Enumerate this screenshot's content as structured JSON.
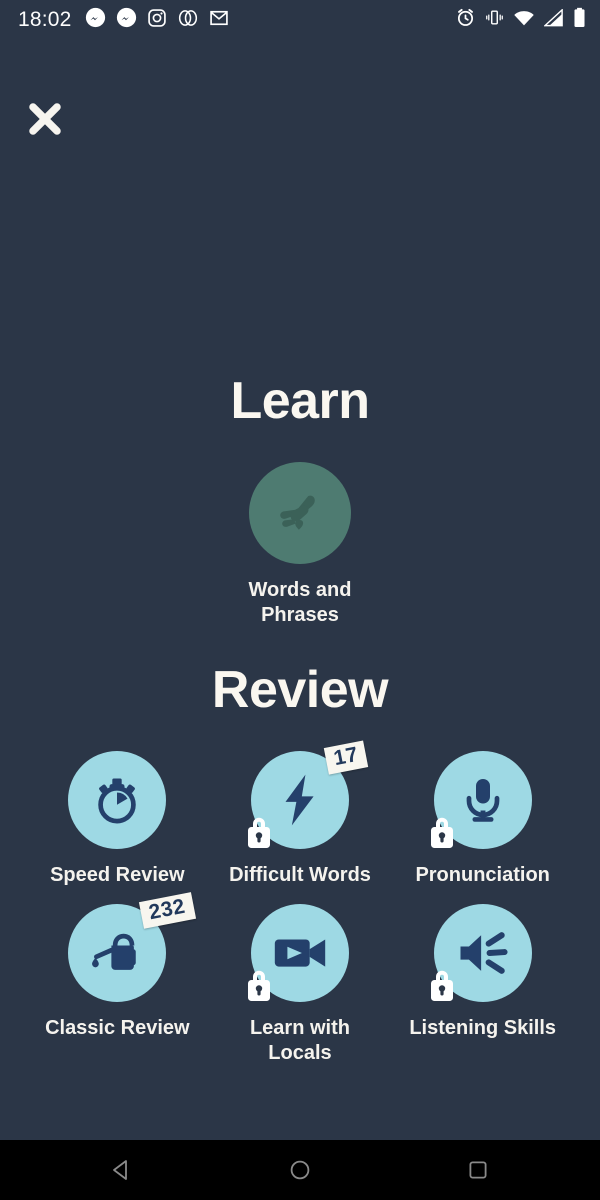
{
  "statusbar": {
    "time": "18:02",
    "left_icons": [
      "messenger-icon",
      "messenger-icon",
      "instagram-icon",
      "overlapping-circles-icon",
      "gmail-icon"
    ],
    "right_icons": [
      "alarm-icon",
      "vibrate-icon",
      "wifi-icon",
      "signal-icon",
      "battery-icon"
    ]
  },
  "header": {
    "close_label": "close-icon"
  },
  "learn": {
    "title": "Learn",
    "tile": {
      "label": "Words and Phrases",
      "icon": "hand-pinch-icon",
      "circle_color": "#4e7b71",
      "icon_color": "#3b6158",
      "locked": false,
      "count": null
    }
  },
  "review": {
    "title": "Review",
    "tiles": [
      {
        "label": "Speed Review",
        "icon": "stopwatch-icon",
        "locked": false,
        "count": null
      },
      {
        "label": "Difficult Words",
        "icon": "lightning-bolt-icon",
        "locked": true,
        "count": "17"
      },
      {
        "label": "Pronunciation",
        "icon": "microphone-icon",
        "locked": true,
        "count": null
      },
      {
        "label": "Classic Review",
        "icon": "watering-can-icon",
        "locked": false,
        "count": "232"
      },
      {
        "label": "Learn with Locals",
        "icon": "video-camera-icon",
        "locked": true,
        "count": null
      },
      {
        "label": "Listening Skills",
        "icon": "speaker-waves-icon",
        "locked": true,
        "count": null
      }
    ]
  },
  "navbar": {
    "back": "back-triangle-icon",
    "home": "home-circle-icon",
    "recents": "recents-square-icon"
  },
  "colors": {
    "background": "#2b3647",
    "tile_circle": "#9ed9e4",
    "tile_icon": "#24406b",
    "text": "#f5f3ee",
    "badge_bg": "#f8f6ef",
    "navbar_bg": "#000000"
  }
}
